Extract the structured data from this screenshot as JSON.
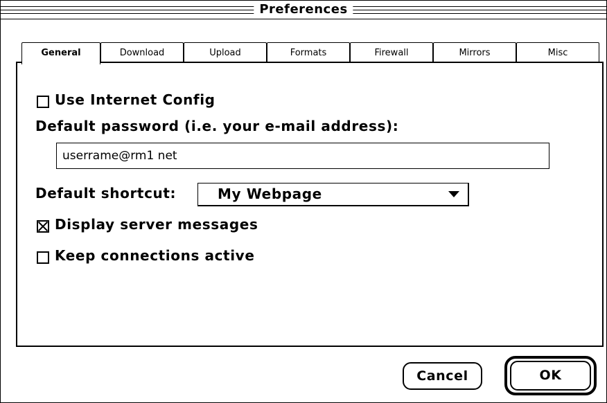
{
  "window": {
    "title": "Preferences"
  },
  "tabs": [
    {
      "label": "General",
      "active": true
    },
    {
      "label": "Download",
      "active": false
    },
    {
      "label": "Upload",
      "active": false
    },
    {
      "label": "Formats",
      "active": false
    },
    {
      "label": "Firewall",
      "active": false
    },
    {
      "label": "Mirrors",
      "active": false
    },
    {
      "label": "Misc",
      "active": false
    }
  ],
  "general": {
    "use_internet_config": {
      "label": "Use Internet Config",
      "checked": false
    },
    "default_password_label": "Default password (i.e. your e-mail address):",
    "default_password_value": "userrame@rm1 net",
    "default_shortcut_label": "Default shortcut:",
    "default_shortcut_value": "My Webpage",
    "display_server_messages": {
      "label": "Display server messages",
      "checked": true
    },
    "keep_connections_active": {
      "label": "Keep connections active",
      "checked": false
    }
  },
  "buttons": {
    "cancel": "Cancel",
    "ok": "OK"
  }
}
